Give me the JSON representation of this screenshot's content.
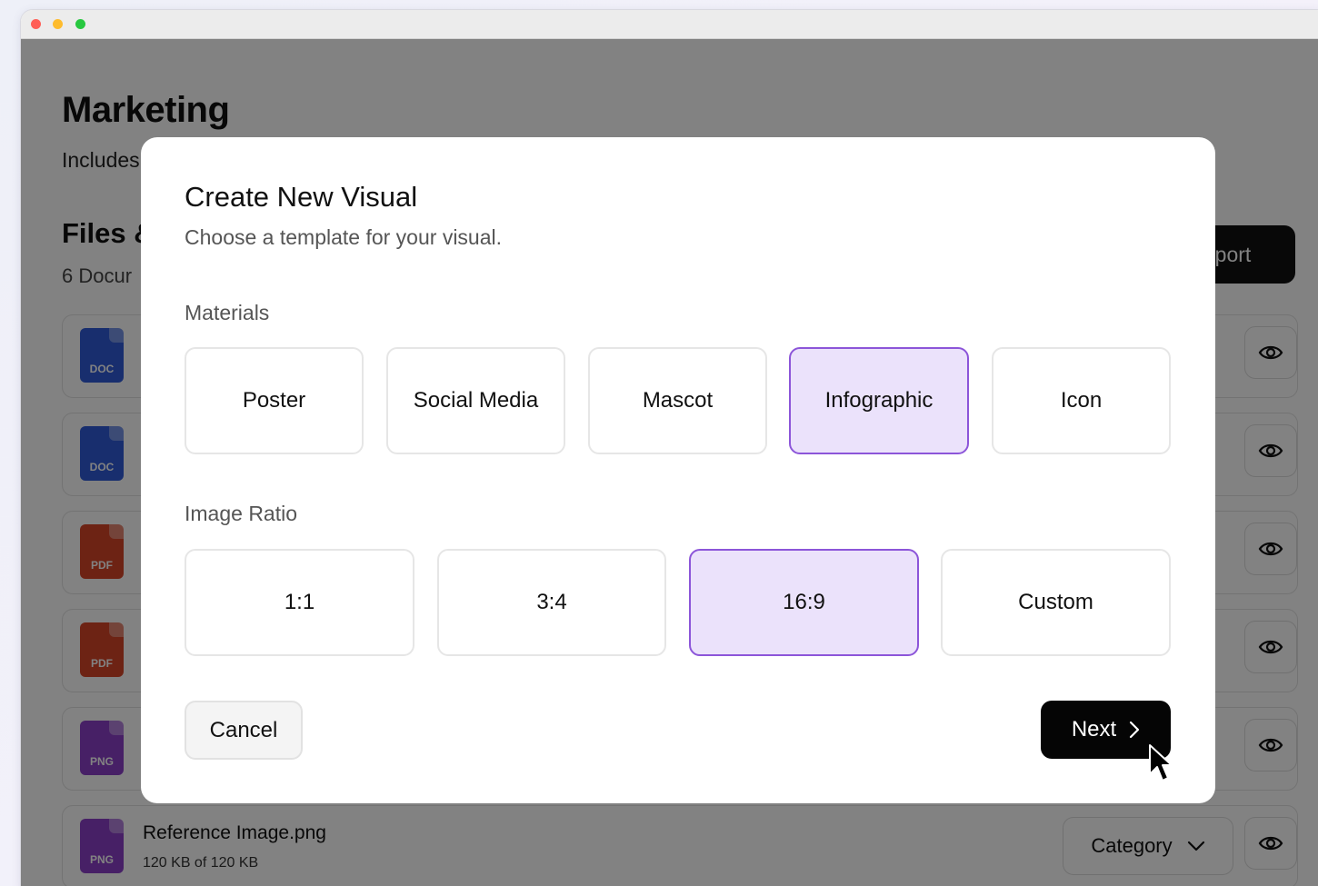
{
  "page": {
    "title": "Marketing",
    "subtitle": "Includes",
    "section_title": "Files &",
    "section_subtitle": "6 Docur",
    "export_label": "port"
  },
  "files": [
    {
      "type": "doc",
      "type_label": "DOC"
    },
    {
      "type": "doc",
      "type_label": "DOC"
    },
    {
      "type": "pdf",
      "type_label": "PDF"
    },
    {
      "type": "pdf",
      "type_label": "PDF"
    },
    {
      "type": "png",
      "type_label": "PNG"
    },
    {
      "type": "png",
      "type_label": "PNG",
      "name": "Reference Image.png",
      "size": "120 KB of 120 KB",
      "category_label": "Category"
    }
  ],
  "modal": {
    "title": "Create New Visual",
    "subtitle": "Choose a template for your visual.",
    "materials_label": "Materials",
    "materials": [
      {
        "label": "Poster",
        "selected": false
      },
      {
        "label": "Social Media",
        "selected": false
      },
      {
        "label": "Mascot",
        "selected": false
      },
      {
        "label": "Infographic",
        "selected": true
      },
      {
        "label": "Icon",
        "selected": false
      }
    ],
    "ratio_label": "Image Ratio",
    "ratios": [
      {
        "label": "1:1",
        "selected": false
      },
      {
        "label": "3:4",
        "selected": false
      },
      {
        "label": "16:9",
        "selected": true
      },
      {
        "label": "Custom",
        "selected": false
      }
    ],
    "cancel_label": "Cancel",
    "next_label": "Next"
  },
  "colors": {
    "accent_border": "#8c55d9",
    "accent_fill": "#ebe2fb",
    "doc": "#2f5bd8",
    "pdf": "#d64528",
    "png": "#8b3fc9"
  }
}
